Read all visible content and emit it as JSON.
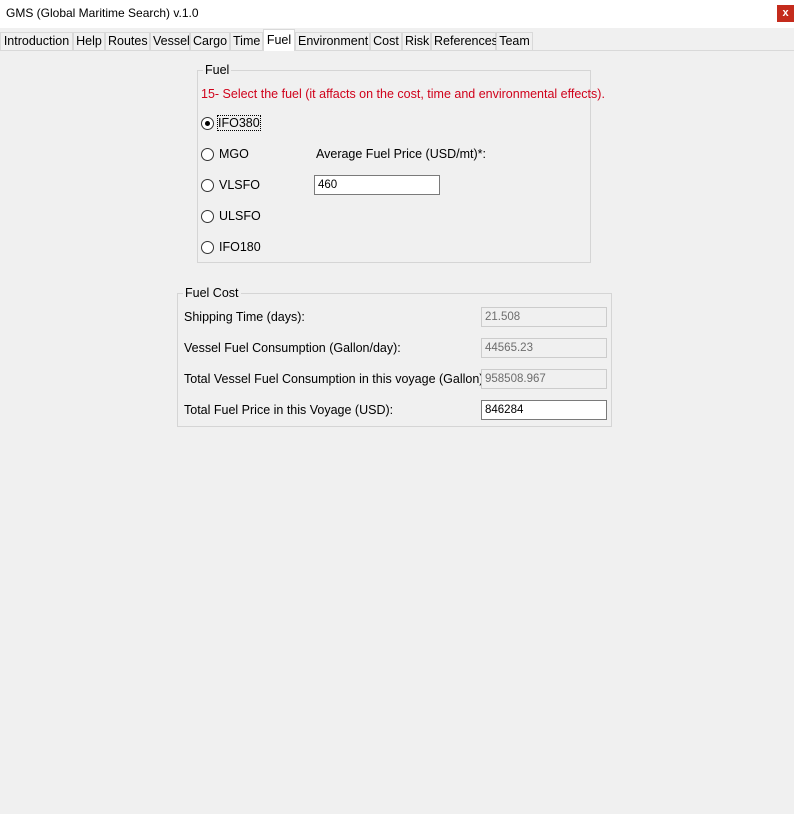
{
  "window": {
    "title": "GMS (Global Maritime Search) v.1.0",
    "close_label": "x"
  },
  "tabs": [
    {
      "label": "Introduction"
    },
    {
      "label": "Help"
    },
    {
      "label": "Routes"
    },
    {
      "label": "Vessel"
    },
    {
      "label": "Cargo"
    },
    {
      "label": "Time"
    },
    {
      "label": "Fuel",
      "active": true
    },
    {
      "label": "Environment"
    },
    {
      "label": "Cost"
    },
    {
      "label": "Risk"
    },
    {
      "label": "References"
    },
    {
      "label": "Team"
    }
  ],
  "fuel_group": {
    "legend": "Fuel",
    "instruction": "15- Select the fuel (it affacts on the cost, time and environmental effects).",
    "options": [
      {
        "label": "IFO380",
        "selected": true
      },
      {
        "label": "MGO",
        "selected": false
      },
      {
        "label": "VLSFO",
        "selected": false
      },
      {
        "label": "ULSFO",
        "selected": false
      },
      {
        "label": "IFO180",
        "selected": false
      }
    ],
    "price_label": "Average Fuel Price (USD/mt)*:",
    "price_value": "460"
  },
  "fuel_cost_group": {
    "legend": "Fuel Cost",
    "rows": [
      {
        "label": "Shipping Time (days):",
        "value": "21.508",
        "enabled": false
      },
      {
        "label": "Vessel Fuel Consumption (Gallon/day):",
        "value": "44565.23",
        "enabled": false
      },
      {
        "label": "Total Vessel Fuel Consumption in this voyage (Gallon):",
        "value": "958508.967",
        "enabled": false
      },
      {
        "label": "Total Fuel Price in this Voyage (USD):",
        "value": "846284",
        "enabled": true
      }
    ]
  }
}
